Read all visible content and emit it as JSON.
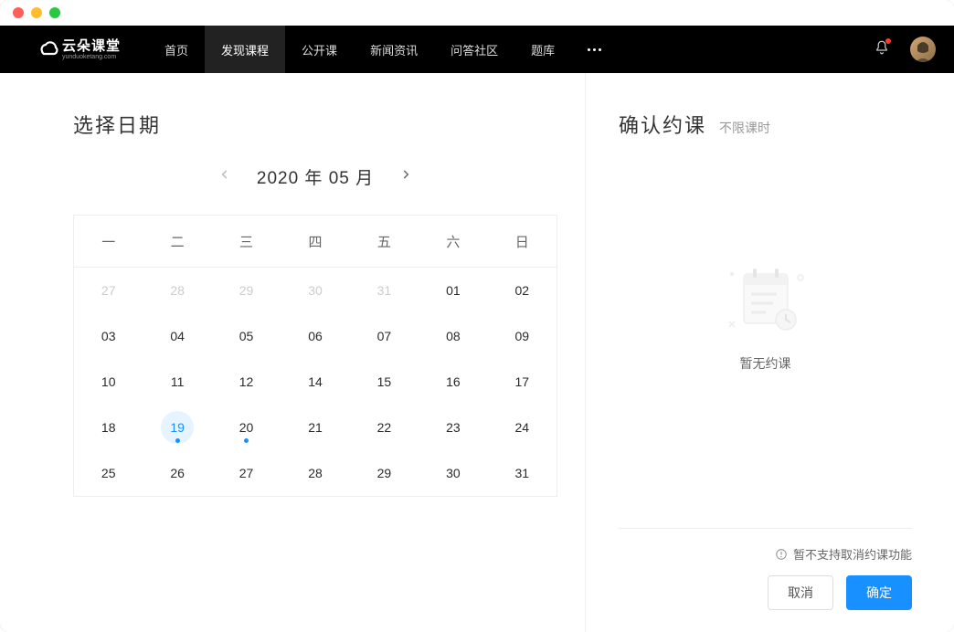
{
  "header": {
    "logo_cn": "云朵课堂",
    "logo_en": "yunduoketang.com"
  },
  "nav": {
    "items": [
      "首页",
      "发现课程",
      "公开课",
      "新闻资讯",
      "问答社区",
      "题库"
    ],
    "active_index": 1
  },
  "left": {
    "title": "选择日期",
    "month_label": "2020 年 05 月",
    "weekdays": [
      "一",
      "二",
      "三",
      "四",
      "五",
      "六",
      "日"
    ],
    "dates": [
      {
        "d": "27",
        "other": true
      },
      {
        "d": "28",
        "other": true
      },
      {
        "d": "29",
        "other": true
      },
      {
        "d": "30",
        "other": true
      },
      {
        "d": "31",
        "other": true
      },
      {
        "d": "01"
      },
      {
        "d": "02"
      },
      {
        "d": "03"
      },
      {
        "d": "04"
      },
      {
        "d": "05"
      },
      {
        "d": "06"
      },
      {
        "d": "07"
      },
      {
        "d": "08"
      },
      {
        "d": "09"
      },
      {
        "d": "10"
      },
      {
        "d": "11"
      },
      {
        "d": "12"
      },
      {
        "d": "14"
      },
      {
        "d": "15"
      },
      {
        "d": "16"
      },
      {
        "d": "17"
      },
      {
        "d": "18"
      },
      {
        "d": "19",
        "today": true,
        "dot": true
      },
      {
        "d": "20",
        "dot": true
      },
      {
        "d": "21"
      },
      {
        "d": "22"
      },
      {
        "d": "23"
      },
      {
        "d": "24"
      },
      {
        "d": "25"
      },
      {
        "d": "26"
      },
      {
        "d": "27"
      },
      {
        "d": "28"
      },
      {
        "d": "29"
      },
      {
        "d": "30"
      },
      {
        "d": "31"
      }
    ]
  },
  "right": {
    "title": "确认约课",
    "subtitle": "不限课时",
    "empty_text": "暂无约课",
    "warning": "暂不支持取消约课功能",
    "cancel_label": "取消",
    "confirm_label": "确定"
  }
}
